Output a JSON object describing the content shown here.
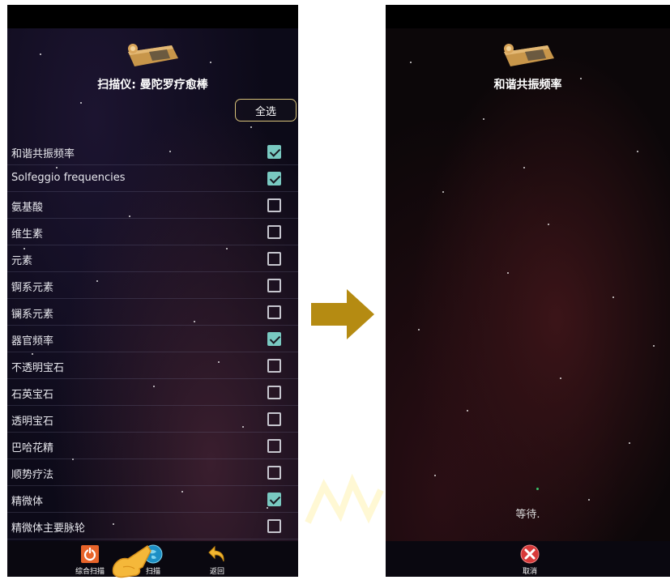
{
  "left_screen": {
    "title": "扫描仪: 曼陀罗疗愈棒",
    "select_all_label": "全选",
    "items": [
      {
        "label": "和谐共振频率",
        "checked": true
      },
      {
        "label": "Solfeggio frequencies",
        "checked": true
      },
      {
        "label": "氨基酸",
        "checked": false
      },
      {
        "label": "维生素",
        "checked": false
      },
      {
        "label": "元素",
        "checked": false
      },
      {
        "label": "锕系元素",
        "checked": false
      },
      {
        "label": "镧系元素",
        "checked": false
      },
      {
        "label": "器官频率",
        "checked": true
      },
      {
        "label": "不透明宝石",
        "checked": false
      },
      {
        "label": "石英宝石",
        "checked": false
      },
      {
        "label": "透明宝石",
        "checked": false
      },
      {
        "label": "巴哈花精",
        "checked": false
      },
      {
        "label": "顺势疗法",
        "checked": false
      },
      {
        "label": "精微体",
        "checked": true
      },
      {
        "label": "精微体主要脉轮",
        "checked": false
      }
    ],
    "nav": {
      "scan_all_label": "综合扫描",
      "scan_label": "扫描",
      "back_label": "返回"
    }
  },
  "right_screen": {
    "title": "和谐共振频率",
    "waiting_text": "等待.",
    "nav": {
      "cancel_label": "取消"
    }
  },
  "colors": {
    "checkbox_checked": "#79c9c1",
    "arrow": "#b58b12",
    "select_border": "#d8c27a"
  }
}
